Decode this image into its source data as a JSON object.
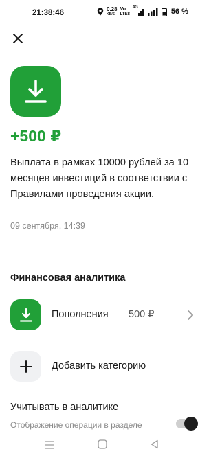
{
  "status_bar": {
    "time": "21:38:46",
    "speed_value": "0.28",
    "speed_unit": "KB/S",
    "volte_top": "Vo",
    "volte_bottom": "LTE8",
    "network": "4G",
    "battery": "56 %"
  },
  "operation": {
    "amount": "+500 ₽",
    "description": "Выплата в рамках 10000 рублей за 10 месяцев инвестиций в соответствии с Правилами проведения акции.",
    "datetime": "09 сентября, 14:39"
  },
  "analytics": {
    "section_title": "Финансовая аналитика",
    "category": {
      "label": "Пополнения",
      "value": "500 ₽"
    },
    "add_category_label": "Добавить категорию",
    "include_title": "Учитывать в аналитике",
    "include_subtitle": "Отображение операции в разделе",
    "include_enabled": true
  },
  "icons": {
    "close": "close-icon",
    "hero": "download-icon",
    "category": "download-icon",
    "add": "plus-icon",
    "chevron": "chevron-right-icon"
  },
  "colors": {
    "accent": "#21a038",
    "secondary_text": "#8a8a8a"
  }
}
